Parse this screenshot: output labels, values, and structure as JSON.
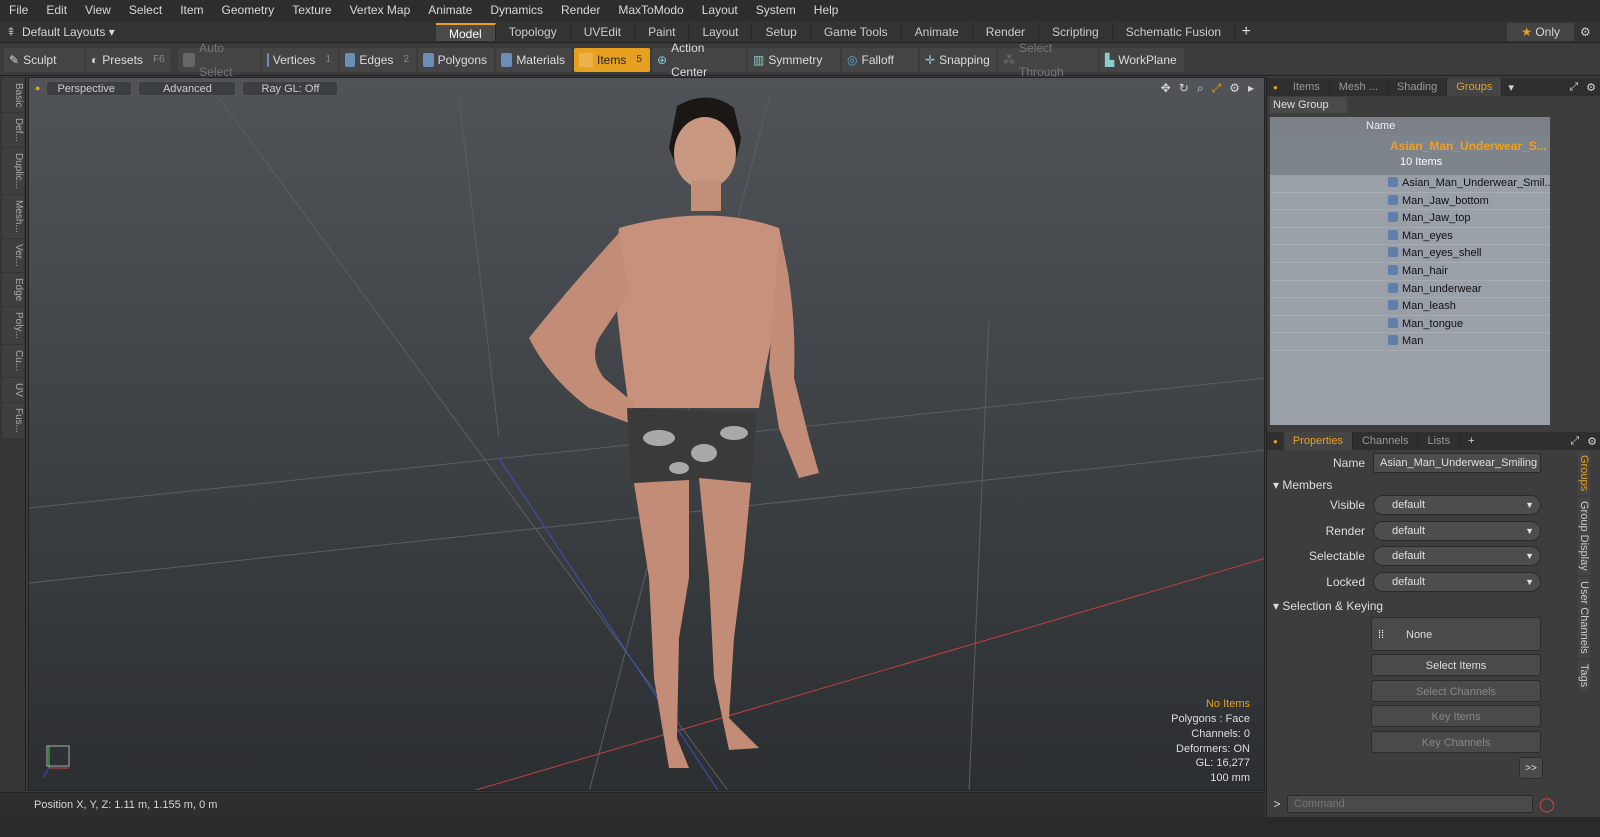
{
  "menu": [
    "File",
    "Edit",
    "View",
    "Select",
    "Item",
    "Geometry",
    "Texture",
    "Vertex Map",
    "Animate",
    "Dynamics",
    "Render",
    "MaxToModo",
    "Layout",
    "System",
    "Help"
  ],
  "layouts": {
    "default_label": "Default Layouts",
    "only_label": "Only"
  },
  "layout_tabs": [
    {
      "label": "Model",
      "active": true
    },
    {
      "label": "Topology"
    },
    {
      "label": "UVEdit"
    },
    {
      "label": "Paint"
    },
    {
      "label": "Layout"
    },
    {
      "label": "Setup"
    },
    {
      "label": "Game Tools"
    },
    {
      "label": "Animate"
    },
    {
      "label": "Render"
    },
    {
      "label": "Scripting"
    },
    {
      "label": "Schematic Fusion"
    }
  ],
  "toolbar": {
    "sculpt": "Sculpt",
    "presets": "Presets",
    "presets_key": "F6",
    "auto_select": "Auto Select",
    "vertices": "Vertices",
    "vertices_key": "1",
    "edges": "Edges",
    "edges_key": "2",
    "polygons": "Polygons",
    "materials": "Materials",
    "items": "Items",
    "items_key": "5",
    "action_center": "Action Center",
    "symmetry": "Symmetry",
    "falloff": "Falloff",
    "snapping": "Snapping",
    "select_through": "Select Through",
    "workplane": "WorkPlane"
  },
  "left_tabs": [
    "Basic",
    "Def...",
    "Duplic...",
    "Mesh...",
    "Ver...",
    "Edge",
    "Poly...",
    "Cu...",
    "UV",
    "Fus..."
  ],
  "viewport": {
    "perspective": "Perspective",
    "advanced": "Advanced",
    "raygl": "Ray GL: Off",
    "info": {
      "selection": "No Items",
      "polygons": "Polygons : Face",
      "channels": "Channels: 0",
      "deformers": "Deformers: ON",
      "gl": "GL: 16,277",
      "scale": "100 mm"
    }
  },
  "status": {
    "position": "Position X, Y, Z:   1.11 m, 1.155 m, 0 m"
  },
  "right_tabs": [
    "Items",
    "Mesh ...",
    "Shading",
    "Groups"
  ],
  "groups": {
    "new_group": "New Group",
    "name_header": "Name",
    "title": "Asian_Man_Underwear_S...",
    "count": "10 Items",
    "items": [
      "Asian_Man_Underwear_Smil...",
      "Man_Jaw_bottom",
      "Man_Jaw_top",
      "Man_eyes",
      "Man_eyes_shell",
      "Man_hair",
      "Man_underwear",
      "Man_leash",
      "Man_tongue",
      "Man"
    ]
  },
  "prop_tabs": [
    "Properties",
    "Channels",
    "Lists"
  ],
  "props": {
    "name_label": "Name",
    "name_value": "Asian_Man_Underwear_Smiling (",
    "members": "Members",
    "rows": [
      {
        "label": "Visible",
        "value": "default"
      },
      {
        "label": "Render",
        "value": "default"
      },
      {
        "label": "Selectable",
        "value": "default"
      },
      {
        "label": "Locked",
        "value": "default"
      }
    ],
    "sel_keying": "Selection & Keying",
    "none": "None",
    "select_items": "Select Items",
    "select_channels": "Select Channels",
    "key_items": "Key Items",
    "key_channels": "Key Channels",
    "more": ">>"
  },
  "side_tabs": [
    "Groups",
    "Group Display",
    "User Channels",
    "Tags"
  ],
  "command": {
    "placeholder": "Command"
  }
}
